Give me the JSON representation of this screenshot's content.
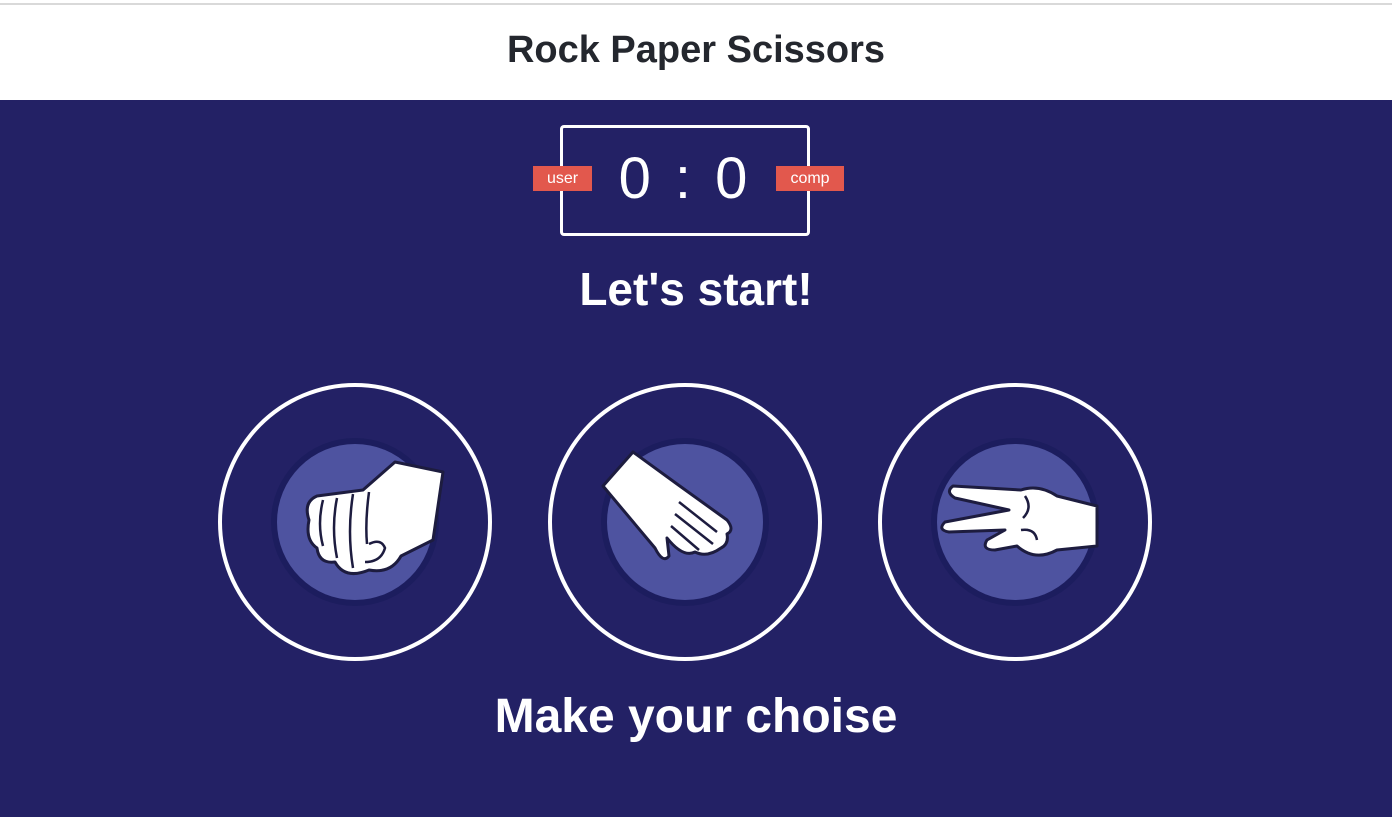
{
  "header": {
    "title": "Rock Paper Scissors"
  },
  "scoreboard": {
    "user_label": "user",
    "comp_label": "comp",
    "score": "0 : 0",
    "user_score": 0,
    "comp_score": 0
  },
  "result_message": "Let's start!",
  "choices": [
    {
      "id": "rock",
      "icon": "fist-icon"
    },
    {
      "id": "paper",
      "icon": "open-hand-icon"
    },
    {
      "id": "scissors",
      "icon": "peace-sign-hand-icon"
    }
  ],
  "prompt": "Make your choise",
  "colors": {
    "background": "#232165",
    "header_bg": "#ffffff",
    "badge": "#e2584d",
    "icon_disc": "#4e53a0",
    "text_light": "#ffffff",
    "text_dark": "#24272e"
  }
}
